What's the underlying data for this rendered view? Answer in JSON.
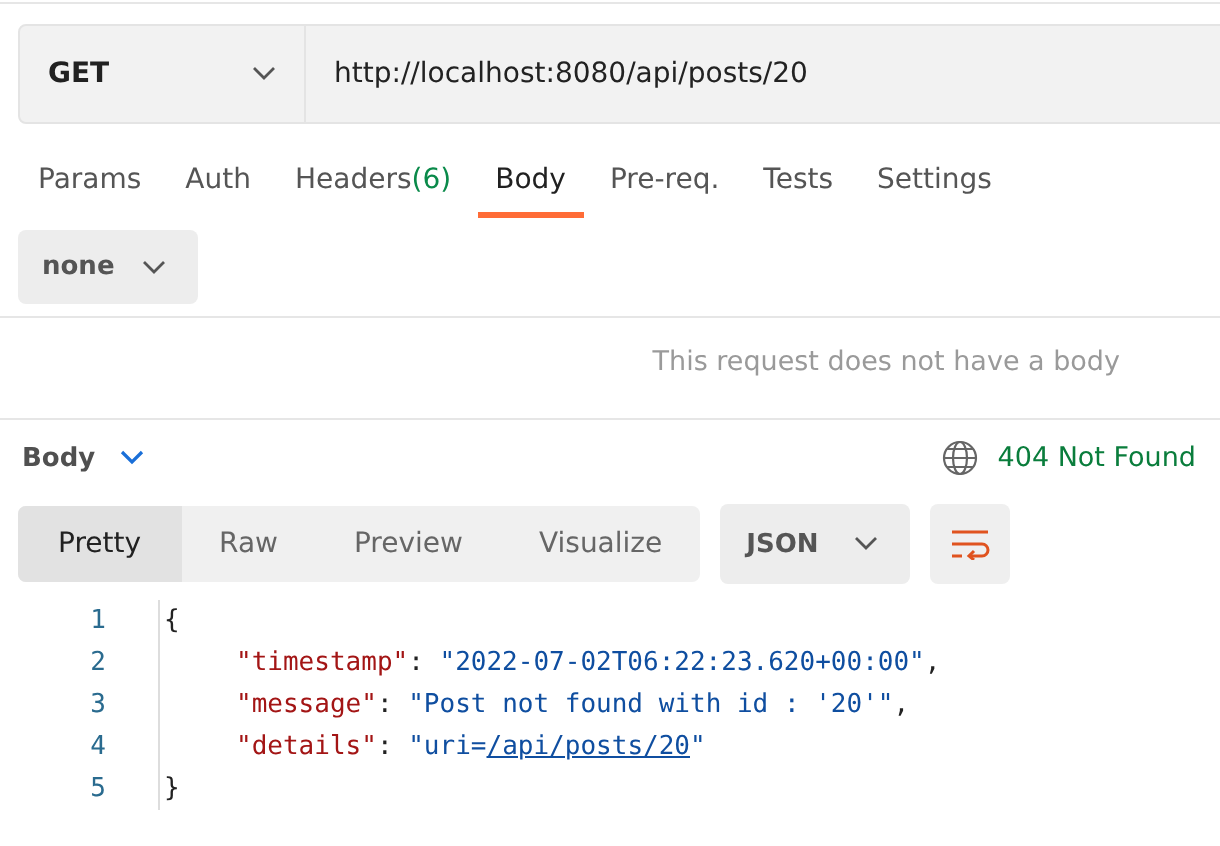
{
  "request": {
    "method": "GET",
    "url": "http://localhost:8080/api/posts/20"
  },
  "tabs": [
    {
      "label": "Params",
      "selected": false
    },
    {
      "label": "Auth",
      "selected": false
    },
    {
      "label": "Headers",
      "count": "(6)",
      "selected": false
    },
    {
      "label": "Body",
      "selected": true
    },
    {
      "label": "Pre-req.",
      "selected": false
    },
    {
      "label": "Tests",
      "selected": false
    },
    {
      "label": "Settings",
      "selected": false
    }
  ],
  "body_type": "none",
  "empty_message": "This request does not have a body",
  "response": {
    "label": "Body",
    "status": "404 Not Found",
    "views": [
      {
        "label": "Pretty",
        "selected": true
      },
      {
        "label": "Raw",
        "selected": false
      },
      {
        "label": "Preview",
        "selected": false
      },
      {
        "label": "Visualize",
        "selected": false
      }
    ],
    "format": "JSON",
    "lines": [
      {
        "number": "1",
        "tokens": [
          {
            "kind": "punct",
            "text": "{"
          }
        ]
      },
      {
        "number": "2",
        "tokens": [
          {
            "kind": "key",
            "text": "\"timestamp\""
          },
          {
            "kind": "punct",
            "text": ": "
          },
          {
            "kind": "string",
            "text": "\"2022-07-02T06:22:23.620+00:00\""
          },
          {
            "kind": "punct",
            "text": ","
          }
        ]
      },
      {
        "number": "3",
        "tokens": [
          {
            "kind": "key",
            "text": "\"message\""
          },
          {
            "kind": "punct",
            "text": ": "
          },
          {
            "kind": "string",
            "text": "\"Post not found with id : '20'\""
          },
          {
            "kind": "punct",
            "text": ","
          }
        ]
      },
      {
        "number": "4",
        "tokens": [
          {
            "kind": "key",
            "text": "\"details\""
          },
          {
            "kind": "punct",
            "text": ": "
          },
          {
            "kind": "string",
            "text": "\"uri="
          },
          {
            "kind": "link",
            "text": "/api/posts/20"
          },
          {
            "kind": "string",
            "text": "\""
          }
        ]
      },
      {
        "number": "5",
        "tokens": [
          {
            "kind": "punct",
            "text": "}"
          }
        ]
      }
    ]
  }
}
